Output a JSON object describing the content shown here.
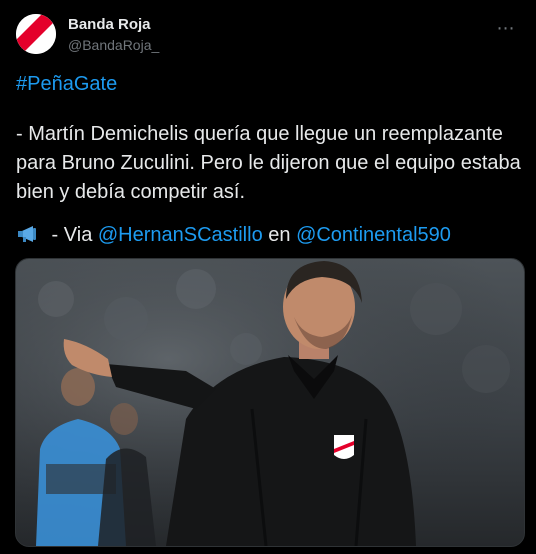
{
  "author": {
    "display_name": "Banda Roja",
    "handle": "@BandaRoja_"
  },
  "tweet": {
    "hashtag": "#PeñaGate",
    "body": "- Martín Demichelis quería que llegue un reemplazante para Bruno Zuculini. Pero le dijeron que el equipo estaba bien y debía competir así.",
    "via_prefix": " - Via ",
    "mention_1": "@HernanSCastillo",
    "via_connector": " en ",
    "mention_2": "@Continental590"
  },
  "icons": {
    "more": "more-horizontal-icon",
    "megaphone": "megaphone-emoji"
  },
  "colors": {
    "background": "#000000",
    "text": "#e7e9ea",
    "secondary": "#71767b",
    "link": "#1d9bf0",
    "brand_red": "#e4002b"
  }
}
